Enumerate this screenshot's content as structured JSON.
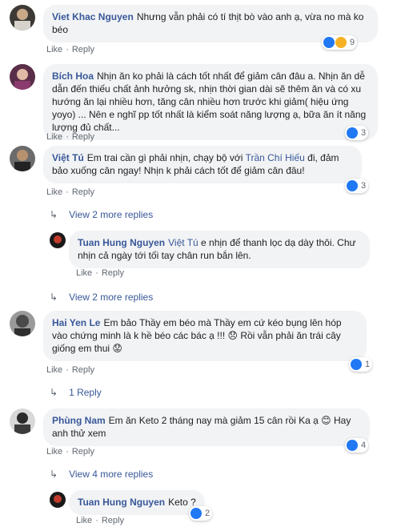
{
  "labels": {
    "like": "Like",
    "reply": "Reply",
    "dot": "·"
  },
  "colors": {
    "link": "#385898",
    "bubble": "#f2f3f5",
    "meta": "#606770",
    "like_icon": "#2078f4"
  },
  "comments": [
    {
      "author": "Viet Khac Nguyen",
      "text": "Nhưng vẫn phải có tí thịt bò vào anh ạ, vừa no mà ko béo",
      "reactions": {
        "icons": [
          "like-icon",
          "haha-icon"
        ],
        "count": "9"
      }
    },
    {
      "author": "Bích Hoa",
      "text": "Nhịn ăn ko phải là cách tốt nhất để giảm cân đâu a. Nhịn ăn dễ dẫn đến thiếu chất ảnh hưởng sk, nhịn thời gian dài sẽ thêm ăn và có xu hướng ăn lại nhiều hơn, tăng cân nhiều hơn trước khi giảm( hiệu ứng yoyo) ... Nên e nghĩ pp tốt nhất là kiểm soát năng lượng ạ, bữa ăn ít năng lượng đủ chất...",
      "reactions": {
        "icons": [
          "like-icon"
        ],
        "count": "3"
      }
    },
    {
      "author": "Việt Tú",
      "text_before": "Em trai cần gì phải nhịn, chạy bộ với ",
      "mention": "Trần Chí Hiếu",
      "text_after": " đi, đảm bảo xuống cân ngay! Nhịn k phải cách tốt để giảm cân đâu!",
      "reactions": {
        "icons": [
          "like-icon"
        ],
        "count": "3"
      },
      "more_replies": "View 2 more replies"
    },
    {
      "author": "Tuan Hung Nguyen",
      "mention": "Việt Tú",
      "text": " e nhịn để thanh lọc dạ dày thôi. Chư nhịn cả ngày tới tối tay chân run bắn lên.",
      "more_replies": "View 2 more replies"
    },
    {
      "author": "Hai Yen Le",
      "text": "Em bảo Thầy em béo mà Thầy em cứ kéo bụng lên hóp vào chứng minh là k hề béo các bác ạ !!! 😞 Rồi vẫn phải ăn trái cây giống em thui 😟",
      "reactions": {
        "icons": [
          "like-icon"
        ],
        "count": "1"
      },
      "more_replies": "1 Reply"
    },
    {
      "author": "Phùng Nam",
      "text": "Em ăn Keto 2 tháng nay mà giảm 15 cân rồi Ka ạ 😊 Hay anh thử xem",
      "reactions": {
        "icons": [
          "like-icon"
        ],
        "count": "4"
      },
      "more_replies": "View 4 more replies"
    },
    {
      "author": "Tuan Hung Nguyen",
      "text": "Keto ?",
      "reactions": {
        "icons": [
          "like-icon"
        ],
        "count": "2"
      }
    }
  ]
}
